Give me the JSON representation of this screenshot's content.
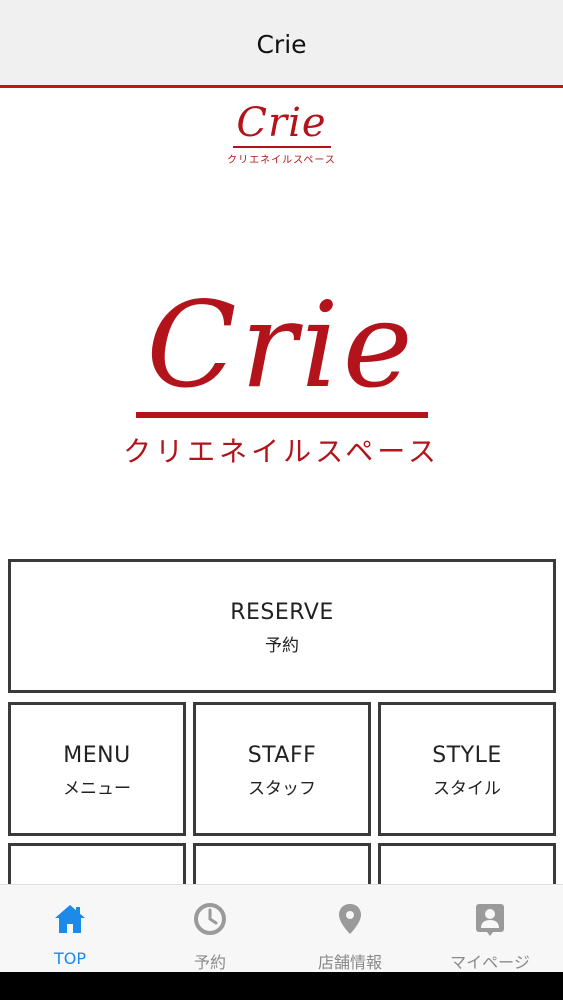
{
  "nav": {
    "title": "Crie"
  },
  "small_logo": {
    "word": "Crie",
    "kana": "クリエネイルスペース"
  },
  "big_logo": {
    "word": "Crie",
    "kana": "クリエネイルスペース"
  },
  "tiles": [
    {
      "en": "RESERVE",
      "ja": "予約"
    },
    {
      "en": "MENU",
      "ja": "メニュー"
    },
    {
      "en": "STAFF",
      "ja": "スタッフ"
    },
    {
      "en": "STYLE",
      "ja": "スタイル"
    }
  ],
  "tabs": [
    {
      "label": "TOP",
      "icon": "home-icon",
      "active": true
    },
    {
      "label": "予約",
      "icon": "clock-icon",
      "active": false
    },
    {
      "label": "店舗情報",
      "icon": "map-pin-icon",
      "active": false
    },
    {
      "label": "マイページ",
      "icon": "contact-card-icon",
      "active": false
    }
  ],
  "colors": {
    "brand": "#b3141b",
    "tab_active": "#1e8ae8",
    "tab_inactive": "#8a8a8a",
    "nav_bg": "#f0f0f0"
  }
}
